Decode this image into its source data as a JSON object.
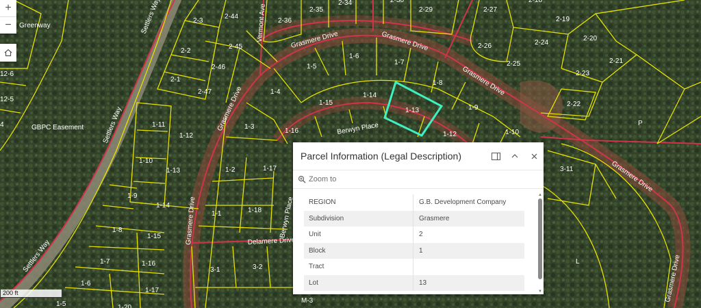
{
  "map": {
    "area_labels": {
      "greenway": "Greenway",
      "easement": "GBPC Easement",
      "p": "P",
      "l": "L",
      "m3": "M-3"
    },
    "roads": {
      "settlers_upper": "Settlers Way",
      "settlers_lower": "Settlers Way",
      "vermont": "Vermont Ave",
      "grasmere_top_left": "Grasmere Drive",
      "grasmere_top_mid": "Grasmere Drive",
      "grasmere_right": "Grasmere Drive",
      "grasmere_far_right": "Grasmere Drive",
      "grasmere_lower_right": "Grasmere Drive",
      "grasmere_left": "Grasmere Drive",
      "grasmere_left_lower": "Grasmere Drive",
      "berwyn_top": "Berwyn Place",
      "berwyn_side": "Berwyn Place",
      "delamere": "Delamere Drive"
    },
    "parcels": {
      "p_2_35": "2-35",
      "p_2_34": "2-34",
      "p_2_30": "2-30",
      "p_2_29": "2-29",
      "p_2_27": "2-27",
      "p_2_18": "2-18",
      "p_2_44": "2-44",
      "p_2_3": "2-3",
      "p_2_36": "2-36",
      "p_2_19": "2-19",
      "p_2_20": "2-20",
      "p_2_45": "2-45",
      "p_2_2": "2-2",
      "p_2_26": "2-26",
      "p_2_24": "2-24",
      "p_2_21": "2-21",
      "p_2_46": "2-46",
      "p_2_25": "2-25",
      "p_2_23": "2-23",
      "p_2_1": "2-1",
      "p_2_47": "2-47",
      "p_2_22": "2-22",
      "p_1_6t": "1-6",
      "p_1_7t": "1-7",
      "p_1_5t": "1-5",
      "p_1_4t": "1-4",
      "p_1_8t": "1-8",
      "p_1_14t": "1-14",
      "p_1_15t": "1-15",
      "p_1_13": "1-13",
      "p_1_9t": "1-9",
      "p_1_3t": "1-3",
      "p_1_16t": "1-16",
      "p_1_12t": "1-12",
      "p_1_10t": "1-10",
      "p_1_2t": "1-2",
      "p_1_17t": "1-17",
      "p_1_18t": "1-18",
      "p_1_1t": "1-1",
      "p_3_11": "3-11",
      "p_3_1": "3-1",
      "p_3_2": "3-2",
      "p_12_6": "12-6",
      "p_12_5": "12-5",
      "p_4": "4",
      "p_1_11l": "1-11",
      "p_1_12l": "1-12",
      "p_1_10l": "1-10",
      "p_1_13l": "1-13",
      "p_1_9l": "1-9",
      "p_1_14l": "1-14",
      "p_1_8l": "1-8",
      "p_1_15l": "1-15",
      "p_1_7l": "1-7",
      "p_1_16l": "1-16",
      "p_1_6l": "1-6",
      "p_1_17l": "1-17",
      "p_1_5l": "1-5",
      "p_1_20l": "1-20"
    }
  },
  "controls": {
    "zoom_in": "+",
    "zoom_out": "−",
    "scale": "200 ft"
  },
  "popup": {
    "title": "Parcel Information (Legal Description)",
    "zoom_to": "Zoom to",
    "rows": [
      {
        "k": "REGION",
        "v": "G.B. Development Company"
      },
      {
        "k": "Subdivision",
        "v": "Grasmere"
      },
      {
        "k": "Unit",
        "v": "2"
      },
      {
        "k": "Block",
        "v": "1"
      },
      {
        "k": "Tract",
        "v": ""
      },
      {
        "k": "Lot",
        "v": "13"
      }
    ]
  },
  "colors": {
    "parcel_line": "#e6e200",
    "road_line": "#d0344a",
    "selected": "#3ff0c0",
    "forest": "#2f3f25"
  }
}
